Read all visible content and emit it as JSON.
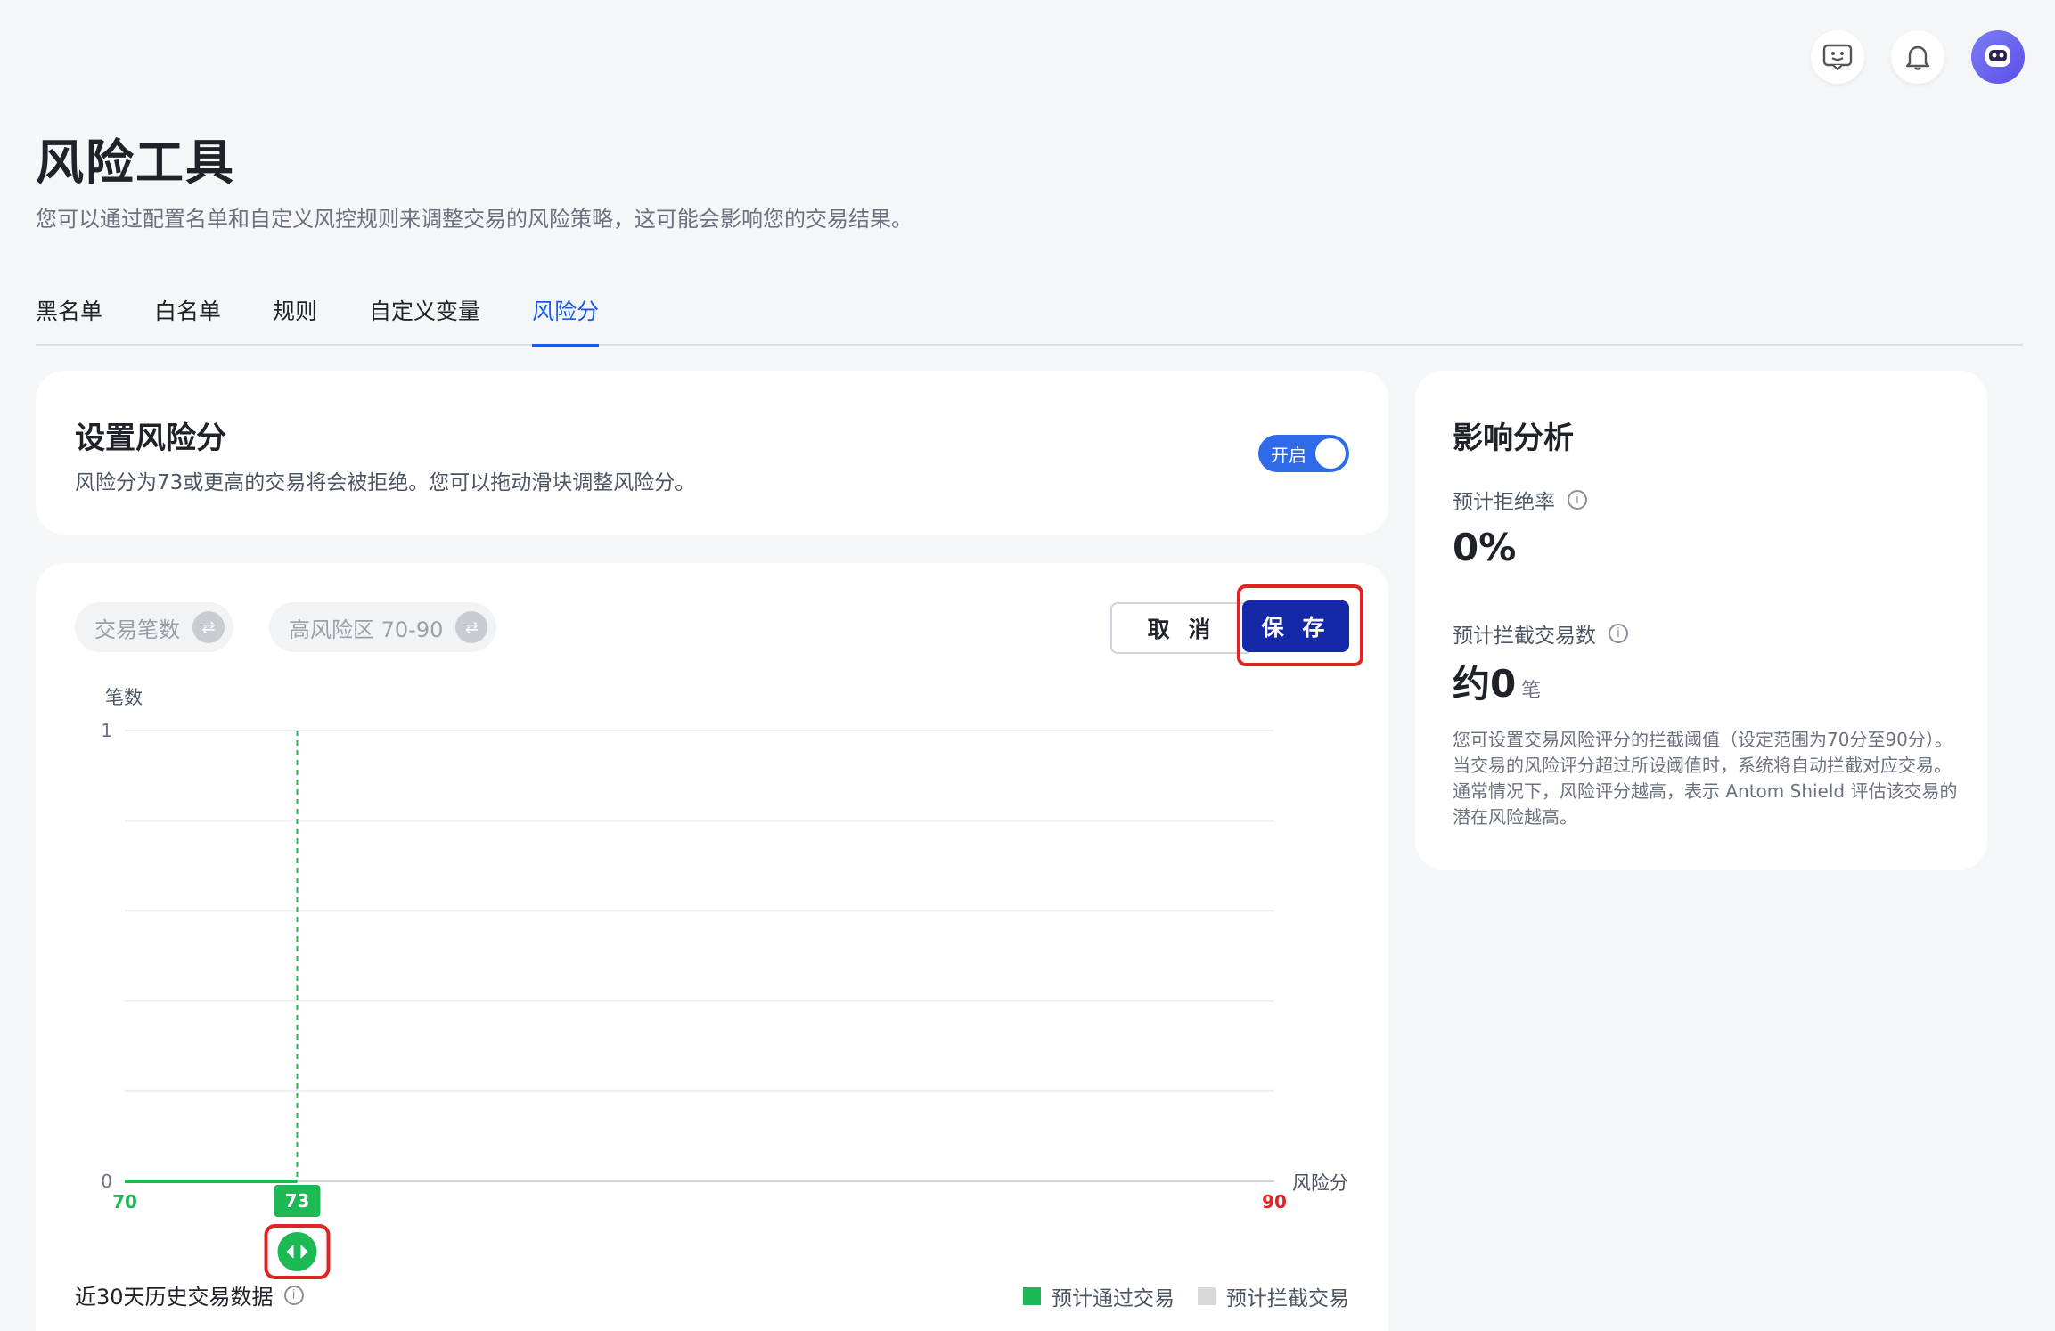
{
  "page": {
    "title": "风险工具",
    "description": "您可以通过配置名单和自定义风控规则来调整交易的风险策略，这可能会影响您的交易结果。"
  },
  "tabs": [
    {
      "label": "黑名单"
    },
    {
      "label": "白名单"
    },
    {
      "label": "规则"
    },
    {
      "label": "自定义变量"
    },
    {
      "label": "风险分",
      "active": true
    }
  ],
  "risk_score": {
    "title": "设置风险分",
    "description": "风险分为73或更高的交易将会被拒绝。您可以拖动滑块调整风险分。",
    "toggle_label": "开启",
    "toggle_on": true
  },
  "chart_panel": {
    "chip_count": "交易笔数",
    "chip_range": "高风险区 70-90",
    "cancel_label": "取 消",
    "save_label": "保 存",
    "history_label": "近30天历史交易数据",
    "slider_value": "73",
    "legend": [
      {
        "label": "预计通过交易",
        "color": "#1db954"
      },
      {
        "label": "预计拦截交易",
        "color": "#d9d9d9"
      }
    ]
  },
  "chart_data": {
    "type": "area",
    "ylabel": "笔数",
    "xlabel": "风险分",
    "xlim": [
      70,
      90
    ],
    "ylim": [
      0,
      1
    ],
    "yticks": [
      "0",
      "1"
    ],
    "x_tick_labels": [
      "70",
      "90"
    ],
    "threshold": 73,
    "series": [
      {
        "name": "预计通过交易",
        "x": [
          70,
          73
        ],
        "values": [
          0,
          0
        ]
      }
    ]
  },
  "impact": {
    "title": "影响分析",
    "reject_rate_label": "预计拒绝率",
    "reject_rate_value": "0%",
    "blocked_label": "预计拦截交易数",
    "blocked_value": "约0",
    "blocked_unit": "笔",
    "note": "您可设置交易风险评分的拦截阈值（设定范围为70分至90分）。当交易的风险评分超过所设阈值时，系统将自动拦截对应交易。通常情况下，风险评分越高，表示 Antom Shield 评估该交易的潜在风险越高。"
  },
  "colors": {
    "accent": "#1a5ae8",
    "save": "#1428a8",
    "pass": "#1db954",
    "high": "#e02424"
  },
  "icons": [
    "feedback-icon",
    "bell-icon",
    "avatar",
    "swap-icon",
    "info-icon",
    "slider-handle-icon"
  ]
}
